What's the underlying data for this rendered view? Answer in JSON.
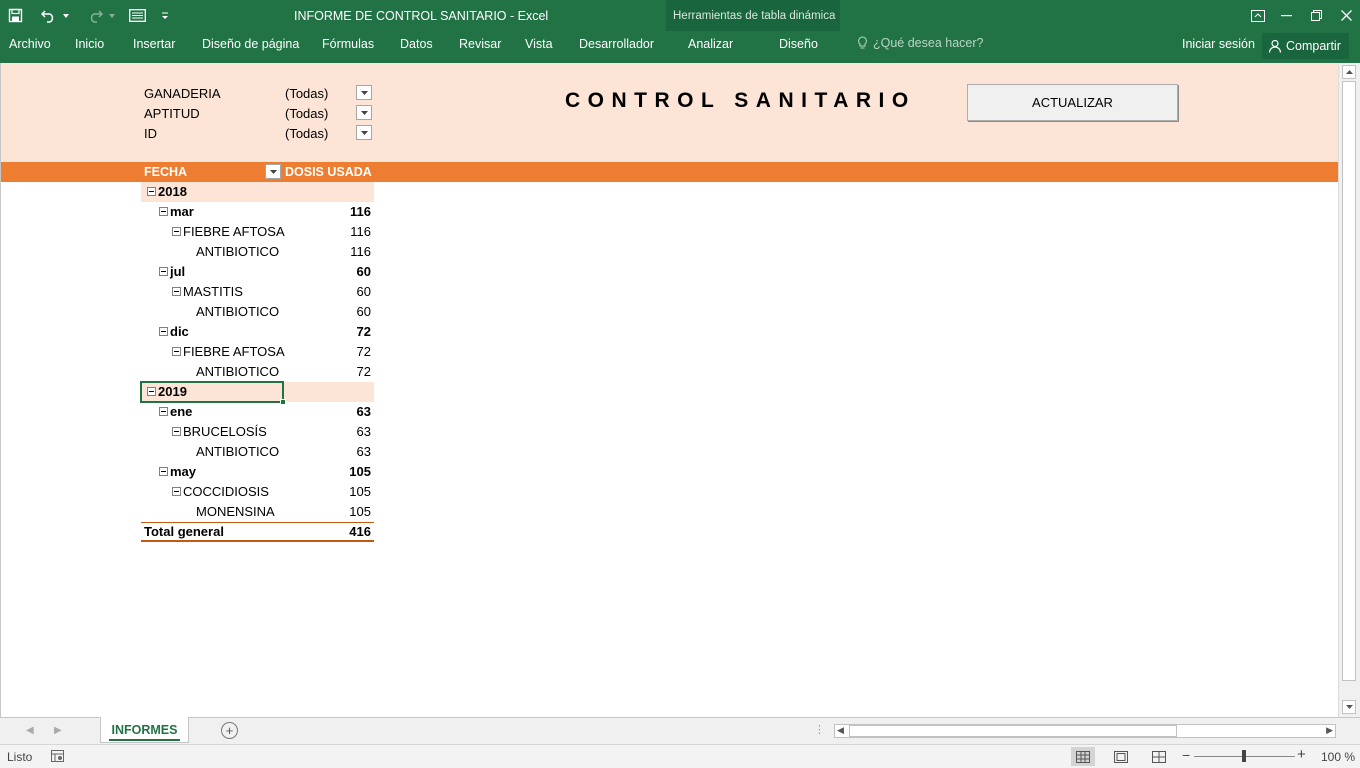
{
  "window": {
    "title": "INFORME DE CONTROL SANITARIO - Excel",
    "context_group": "Herramientas de tabla dinámica"
  },
  "ribbon": {
    "tabs": [
      "Archivo",
      "Inicio",
      "Insertar",
      "Diseño de página",
      "Fórmulas",
      "Datos",
      "Revisar",
      "Vista",
      "Desarrollador",
      "Analizar",
      "Diseño"
    ],
    "tell_me": "¿Qué desea hacer?",
    "sign_in": "Iniciar sesión",
    "share": "Compartir"
  },
  "report": {
    "filters": [
      {
        "name": "GANADERIA",
        "value": "(Todas)"
      },
      {
        "name": "APTITUD",
        "value": "(Todas)"
      },
      {
        "name": "ID",
        "value": "(Todas)"
      }
    ],
    "title": "CONTROL SANITARIO",
    "refresh_button": "ACTUALIZAR",
    "pivot": {
      "col_headers": [
        "FECHA",
        "DOSIS USADA"
      ],
      "rows": [
        {
          "label": "2018",
          "value": "",
          "level": 0,
          "kind": "year"
        },
        {
          "label": "mar",
          "value": "116",
          "level": 1,
          "kind": "month"
        },
        {
          "label": "FIEBRE AFTOSA",
          "value": "116",
          "level": 2,
          "kind": "disease"
        },
        {
          "label": "ANTIBIOTICO",
          "value": "116",
          "level": 3,
          "kind": "drug"
        },
        {
          "label": "jul",
          "value": "60",
          "level": 1,
          "kind": "month"
        },
        {
          "label": "MASTITIS",
          "value": "60",
          "level": 2,
          "kind": "disease"
        },
        {
          "label": "ANTIBIOTICO",
          "value": "60",
          "level": 3,
          "kind": "drug"
        },
        {
          "label": "dic",
          "value": "72",
          "level": 1,
          "kind": "month"
        },
        {
          "label": "FIEBRE AFTOSA",
          "value": "72",
          "level": 2,
          "kind": "disease"
        },
        {
          "label": "ANTIBIOTICO",
          "value": "72",
          "level": 3,
          "kind": "drug"
        },
        {
          "label": "2019",
          "value": "",
          "level": 0,
          "kind": "year"
        },
        {
          "label": "ene",
          "value": "63",
          "level": 1,
          "kind": "month"
        },
        {
          "label": "BRUCELOSÍS",
          "value": "63",
          "level": 2,
          "kind": "disease"
        },
        {
          "label": "ANTIBIOTICO",
          "value": "63",
          "level": 3,
          "kind": "drug"
        },
        {
          "label": "may",
          "value": "105",
          "level": 1,
          "kind": "month"
        },
        {
          "label": "COCCIDIOSIS",
          "value": "105",
          "level": 2,
          "kind": "disease"
        },
        {
          "label": "MONENSINA",
          "value": "105",
          "level": 3,
          "kind": "drug"
        }
      ],
      "total_label": "Total general",
      "total_value": "416"
    }
  },
  "sheets": {
    "active": "INFORMES"
  },
  "status": {
    "text": "Listo",
    "zoom": "100 %"
  },
  "colors": {
    "excel_green": "#217346",
    "band_light": "#fce4d6",
    "band_orange": "#ed7d31"
  }
}
